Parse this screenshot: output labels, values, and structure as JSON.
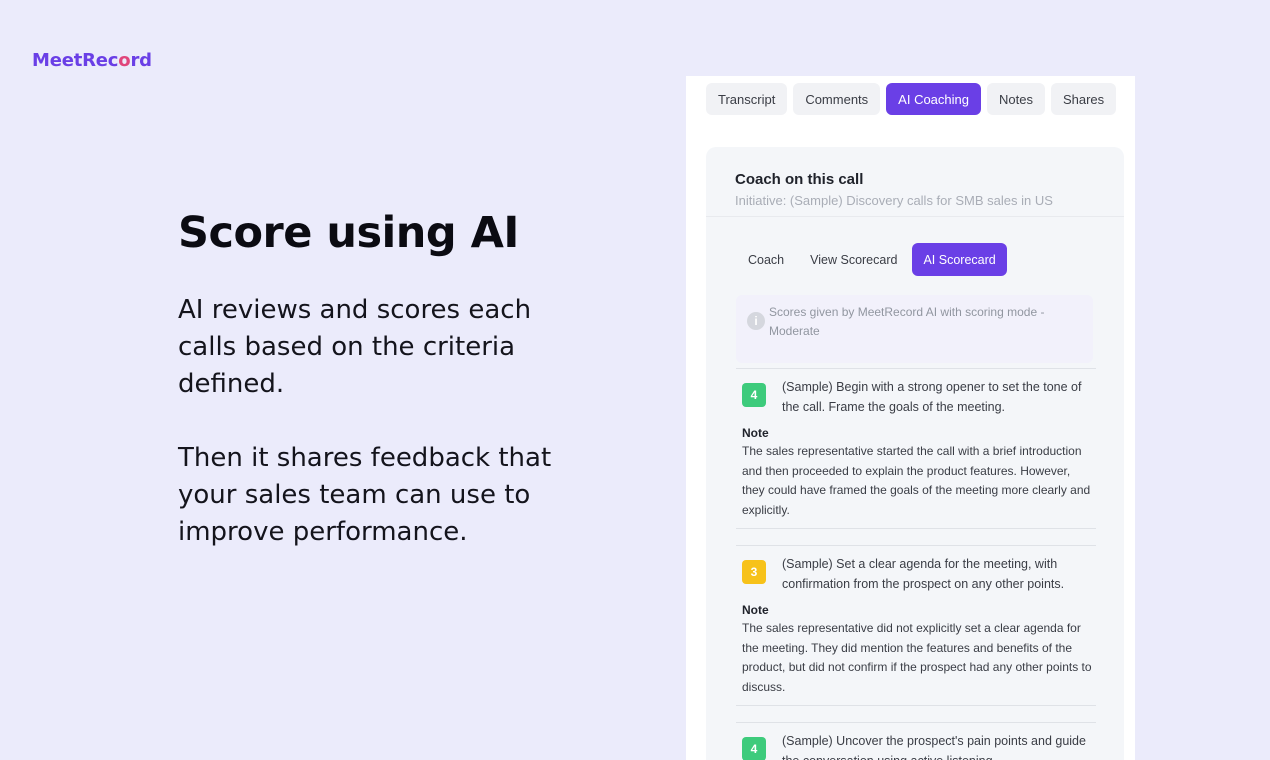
{
  "brand": {
    "name_prefix": "MeetRec",
    "name_accent": "o",
    "name_suffix": "rd"
  },
  "hero": {
    "title": "Score using AI",
    "paragraph1": "AI reviews and scores each calls based on the criteria defined.",
    "paragraph2": "Then it shares feedback that your sales team can use to improve performance."
  },
  "tabs": [
    {
      "label": "Transcript",
      "active": false
    },
    {
      "label": "Comments",
      "active": false
    },
    {
      "label": "AI Coaching",
      "active": true
    },
    {
      "label": "Notes",
      "active": false
    },
    {
      "label": "Shares",
      "active": false
    }
  ],
  "coach": {
    "title": "Coach on this call",
    "subtitle": "Initiative: (Sample) Discovery calls for SMB sales in US",
    "subtabs": [
      {
        "label": "Coach",
        "active": false
      },
      {
        "label": "View Scorecard",
        "active": false
      },
      {
        "label": "AI Scorecard",
        "active": true
      }
    ],
    "info_icon": "i",
    "info_text": "Scores given by MeetRecord AI with scoring mode - Moderate",
    "note_label": "Note",
    "items": [
      {
        "score": "4",
        "score_color": "#3dcb7c",
        "question": "(Sample) Begin with a strong opener to set the tone of the call. Frame the goals of the meeting.",
        "note": "The sales representative started the call with a brief introduction and then proceeded to explain the product features. However, they could have framed the goals of the meeting more clearly and explicitly."
      },
      {
        "score": "3",
        "score_color": "#f7c21a",
        "question": "(Sample) Set a clear agenda for the meeting, with confirmation from the prospect on any other points.",
        "note": "The sales representative did not explicitly set a clear agenda for the meeting. They did mention the features and benefits of the product, but did not confirm if the prospect had any other points to discuss."
      },
      {
        "score": "4",
        "score_color": "#3dcb7c",
        "question": "(Sample) Uncover the prospect's pain points and guide the conversation using active listening.",
        "note": ""
      }
    ]
  },
  "colors": {
    "accent": "#6a3fe6",
    "background": "#ebebfb"
  }
}
